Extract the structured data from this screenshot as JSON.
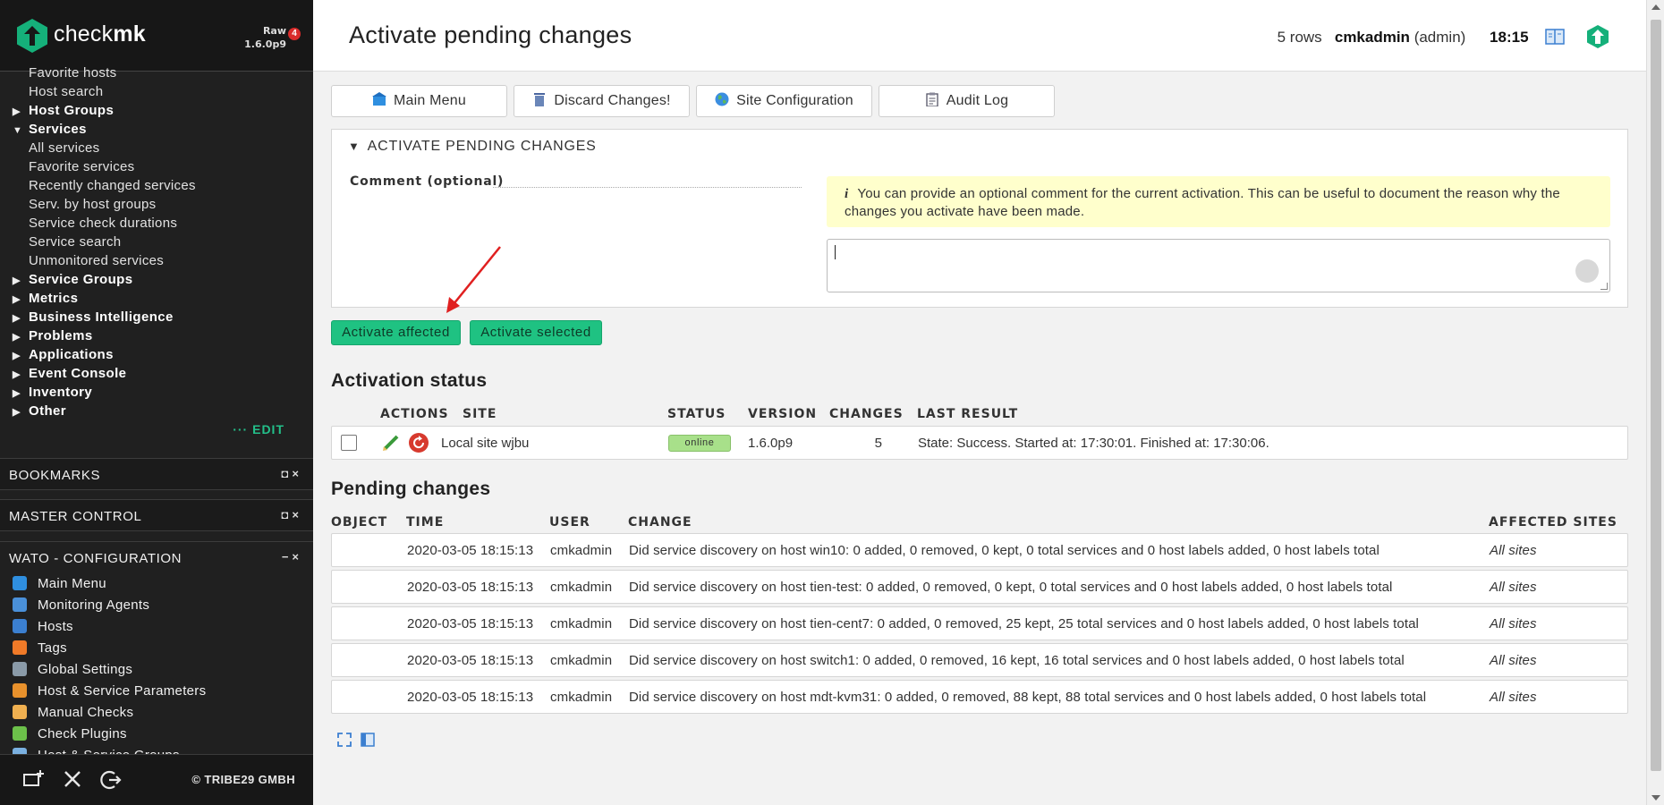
{
  "brand": {
    "logo_text_light": "check",
    "logo_text_bold": "mk",
    "edition": "Raw",
    "version": "1.6.0p9",
    "badge_count": "4"
  },
  "sidebar": {
    "views": {
      "partial_item": "Favorite hosts",
      "items": [
        {
          "label": "Host search",
          "kind": "item"
        },
        {
          "label": "Host Groups",
          "kind": "group",
          "expanded": false
        },
        {
          "label": "Services",
          "kind": "group",
          "expanded": true
        },
        {
          "label": "All services",
          "kind": "item"
        },
        {
          "label": "Favorite services",
          "kind": "item"
        },
        {
          "label": "Recently changed services",
          "kind": "item"
        },
        {
          "label": "Serv. by host groups",
          "kind": "item"
        },
        {
          "label": "Service check durations",
          "kind": "item"
        },
        {
          "label": "Service search",
          "kind": "item"
        },
        {
          "label": "Unmonitored services",
          "kind": "item"
        },
        {
          "label": "Service Groups",
          "kind": "group",
          "expanded": false
        },
        {
          "label": "Metrics",
          "kind": "group",
          "expanded": false
        },
        {
          "label": "Business Intelligence",
          "kind": "group",
          "expanded": false
        },
        {
          "label": "Problems",
          "kind": "group",
          "expanded": false
        },
        {
          "label": "Applications",
          "kind": "group",
          "expanded": false
        },
        {
          "label": "Event Console",
          "kind": "group",
          "expanded": false
        },
        {
          "label": "Inventory",
          "kind": "group",
          "expanded": false
        },
        {
          "label": "Other",
          "kind": "group",
          "expanded": false
        }
      ],
      "edit_label": "··· EDIT"
    },
    "snapins": {
      "bookmarks": "BOOKMARKS",
      "master_control": "MASTER CONTROL",
      "wato": "WATO - CONFIGURATION"
    },
    "wato_items": [
      {
        "label": "Main Menu",
        "icon": "main-menu-icon",
        "color": "#2f8fe0"
      },
      {
        "label": "Monitoring Agents",
        "icon": "agents-icon",
        "color": "#4a90d9"
      },
      {
        "label": "Hosts",
        "icon": "hosts-icon",
        "color": "#3b7fd0"
      },
      {
        "label": "Tags",
        "icon": "tags-icon",
        "color": "#f07a28"
      },
      {
        "label": "Global Settings",
        "icon": "gear-icon",
        "color": "#8a9aa8"
      },
      {
        "label": "Host & Service Parameters",
        "icon": "parameters-icon",
        "color": "#e8912c"
      },
      {
        "label": "Manual Checks",
        "icon": "manual-checks-icon",
        "color": "#f0b050"
      },
      {
        "label": "Check Plugins",
        "icon": "plugins-icon",
        "color": "#6cc04a"
      },
      {
        "label": "Host & Service Groups",
        "icon": "groups-icon",
        "color": "#7ab0e0"
      }
    ],
    "footer": {
      "copyright": "© TRIBE29 GMBH"
    }
  },
  "header": {
    "title": "Activate pending changes",
    "rows": "5 rows",
    "user": "cmkadmin",
    "role": "(admin)",
    "time": "18:15"
  },
  "toolbar": {
    "main_menu": "Main Menu",
    "discard": "Discard Changes!",
    "site_config": "Site Configuration",
    "audit_log": "Audit Log"
  },
  "activate_box": {
    "heading": "ACTIVATE PENDING CHANGES",
    "comment_label": "Comment (optional)",
    "help_text": "You can provide an optional comment for the current activation. This can be useful to document the reason why the changes you activate have been made.",
    "comment_value": ""
  },
  "buttons": {
    "activate_affected": "Activate affected",
    "activate_selected": "Activate selected"
  },
  "activation_status": {
    "title": "Activation status",
    "headers": {
      "actions": "ACTIONS",
      "site": "SITE",
      "status": "STATUS",
      "version": "VERSION",
      "changes": "CHANGES",
      "last_result": "LAST RESULT"
    },
    "row": {
      "site": "Local site wjbu",
      "status": "online",
      "version": "1.6.0p9",
      "changes": "5",
      "last_result": "State: Success. Started at: 17:30:01. Finished at: 17:30:06."
    }
  },
  "pending_changes": {
    "title": "Pending changes",
    "headers": {
      "object": "OBJECT",
      "time": "TIME",
      "user": "USER",
      "change": "CHANGE",
      "affected": "AFFECTED SITES"
    },
    "rows": [
      {
        "time": "2020-03-05 18:15:13",
        "user": "cmkadmin",
        "change": "Did service discovery on host win10: 0 added, 0 removed, 0 kept, 0 total services and 0 host labels added, 0 host labels total",
        "affected": "All sites"
      },
      {
        "time": "2020-03-05 18:15:13",
        "user": "cmkadmin",
        "change": "Did service discovery on host tien-test: 0 added, 0 removed, 0 kept, 0 total services and 0 host labels added, 0 host labels total",
        "affected": "All sites"
      },
      {
        "time": "2020-03-05 18:15:13",
        "user": "cmkadmin",
        "change": "Did service discovery on host tien-cent7: 0 added, 0 removed, 25 kept, 25 total services and 0 host labels added, 0 host labels total",
        "affected": "All sites"
      },
      {
        "time": "2020-03-05 18:15:13",
        "user": "cmkadmin",
        "change": "Did service discovery on host switch1: 0 added, 0 removed, 16 kept, 16 total services and 0 host labels added, 0 host labels total",
        "affected": "All sites"
      },
      {
        "time": "2020-03-05 18:15:13",
        "user": "cmkadmin",
        "change": "Did service discovery on host mdt-kvm31: 0 added, 0 removed, 88 kept, 88 total services and 0 host labels added, 0 host labels total",
        "affected": "All sites"
      }
    ]
  },
  "colors": {
    "accent_green": "#1fc282",
    "sidebar_bg": "#202020",
    "online_green": "#a8e08a",
    "help_yellow": "#ffffcc",
    "arrow_red": "#e02020"
  }
}
